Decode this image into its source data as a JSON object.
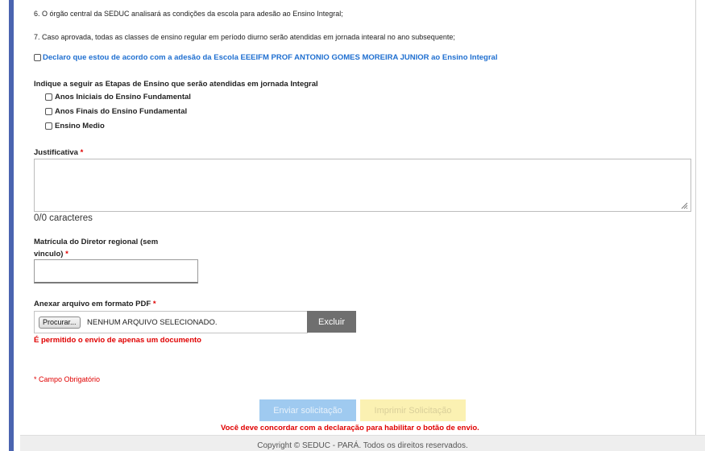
{
  "rules": {
    "item6": "6. O órgão central da SEDUC analisará as condições da escola para adesão ao Ensino Integral;",
    "item7": "7. Caso aprovada, todas as classes de ensino regular em período diurno serão atendidas em jornada intearal no ano subsequente;"
  },
  "declaration": {
    "label": "Declaro que estou de acordo com a adesão da Escola EEEIFM PROF ANTONIO GOMES MOREIRA JUNIOR ao Ensino Integral",
    "checked": false
  },
  "stages": {
    "heading": "Indique a seguir as Etapas de Ensino que serão atendidas em jornada Integral",
    "options": [
      {
        "label": "Anos Iniciais do Ensino Fundamental",
        "checked": false
      },
      {
        "label": "Anos Finais do Ensino Fundamental",
        "checked": false
      },
      {
        "label": "Ensino Medio",
        "checked": false
      }
    ]
  },
  "justificativa": {
    "label": "Justificativa",
    "required_mark": "*",
    "value": "",
    "counter": "0/0 caracteres"
  },
  "matricula": {
    "label_line1": "Matrícula do Diretor regional (sem",
    "label_line2": "vinculo)",
    "required_mark": "*",
    "value": ""
  },
  "attachment": {
    "label": "Anexar arquivo em formato PDF",
    "required_mark": "*",
    "browse_label": "Procurar...",
    "file_status": "NENHUM ARQUIVO SELECIONADO.",
    "delete_label": "Excluir",
    "note": "É permitido o envio de apenas um documento"
  },
  "required_note": "* Campo Obrigatório",
  "actions": {
    "submit_label": "Enviar solicitação",
    "print_label": "Imprimir Solicitação",
    "warning": "Você deve concordar com a declaração para habilitar o botão de envio."
  },
  "footer": {
    "text": "Copyright © SEDUC - PARÁ. Todos os direitos reservados."
  },
  "colors": {
    "accent_blue": "#1f6fd0",
    "required_red": "#e00000",
    "submit_disabled": "#9fcaf0",
    "print_disabled": "#fbf1b2",
    "delete_button": "#6f6f6f",
    "left_bar": "#4a64b0"
  }
}
